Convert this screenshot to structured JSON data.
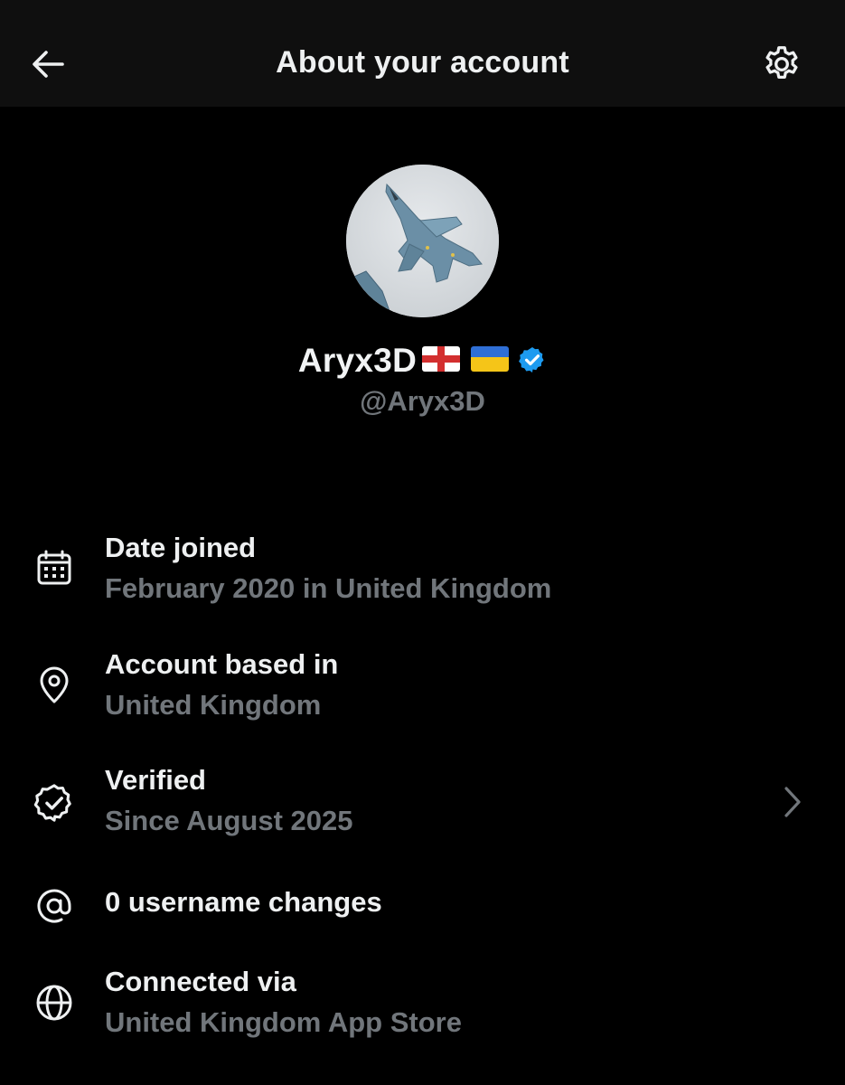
{
  "header": {
    "title": "About your account",
    "back_icon": "arrow-left-icon",
    "settings_icon": "gear-icon"
  },
  "profile": {
    "display_name": "Aryx3D",
    "flags": [
      "england-flag-icon",
      "ukraine-flag-icon"
    ],
    "verified_icon": "verified-badge-icon",
    "handle": "@Aryx3D",
    "avatar": "fighter-jet-avatar"
  },
  "info": {
    "date_joined": {
      "label": "Date joined",
      "value": "February 2020 in United Kingdom",
      "icon": "calendar-icon"
    },
    "based_in": {
      "label": "Account based in",
      "value": "United Kingdom",
      "icon": "location-pin-icon"
    },
    "verified": {
      "label": "Verified",
      "value": "Since August 2025",
      "icon": "verified-check-icon",
      "chevron": "chevron-right-icon"
    },
    "username_changes": {
      "label": "0 username changes",
      "icon": "at-sign-icon"
    },
    "connected_via": {
      "label": "Connected via",
      "value": "United Kingdom App Store",
      "icon": "globe-icon"
    }
  },
  "colors": {
    "background": "#000000",
    "header_bg": "#0f0f0f",
    "primary_text": "#e7e9ea",
    "secondary_text": "#71767b",
    "verified_blue": "#1d9bf0"
  }
}
